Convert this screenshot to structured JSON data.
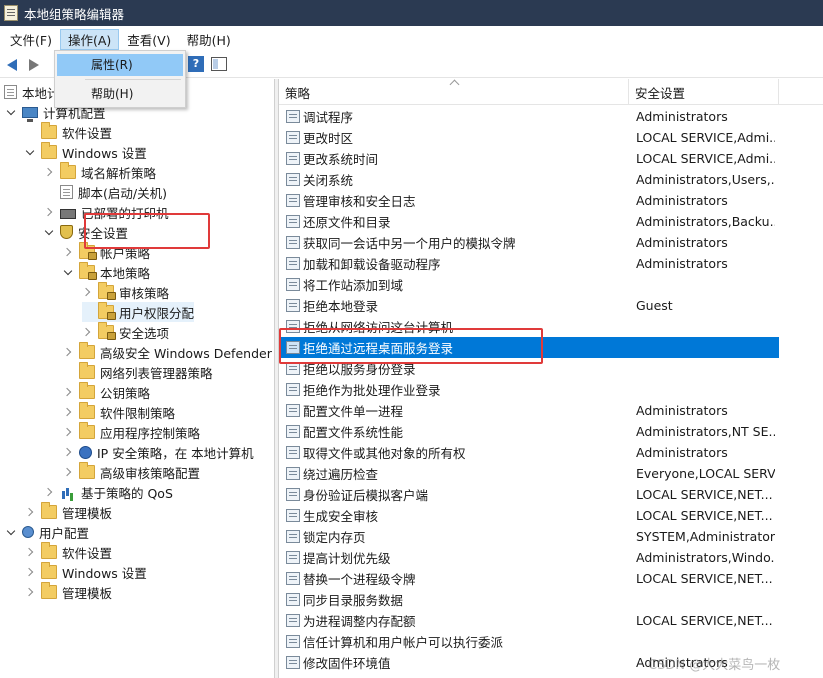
{
  "window": {
    "title": "本地组策略编辑器"
  },
  "menubar": {
    "items": [
      {
        "label": "文件(F)"
      },
      {
        "label": "操作(A)"
      },
      {
        "label": "查看(V)"
      },
      {
        "label": "帮助(H)"
      }
    ]
  },
  "dropdown": {
    "properties": "属性(R)",
    "help": "帮助(H)"
  },
  "tree": {
    "root": "本地计",
    "items": [
      {
        "label": "计算机配置",
        "level": 0,
        "expand": "open",
        "icon": "computer"
      },
      {
        "label": "软件设置",
        "level": 1,
        "expand": "none",
        "icon": "folder"
      },
      {
        "label": "Windows 设置",
        "level": 1,
        "expand": "open",
        "icon": "folder"
      },
      {
        "label": "域名解析策略",
        "level": 2,
        "expand": "closed",
        "icon": "folder"
      },
      {
        "label": "脚本(启动/关机)",
        "level": 2,
        "expand": "none",
        "icon": "doc"
      },
      {
        "label": "已部署的打印机",
        "level": 2,
        "expand": "closed",
        "icon": "printer"
      },
      {
        "label": "安全设置",
        "level": 2,
        "expand": "open",
        "icon": "shield"
      },
      {
        "label": "帐户策略",
        "level": 3,
        "expand": "closed",
        "icon": "folder-lock"
      },
      {
        "label": "本地策略",
        "level": 3,
        "expand": "open",
        "icon": "folder-lock"
      },
      {
        "label": "审核策略",
        "level": 4,
        "expand": "closed",
        "icon": "folder-lock"
      },
      {
        "label": "用户权限分配",
        "level": 4,
        "expand": "none",
        "icon": "folder-lock",
        "selected": true
      },
      {
        "label": "安全选项",
        "level": 4,
        "expand": "closed",
        "icon": "folder-lock"
      },
      {
        "label": "高级安全 Windows Defender 防",
        "level": 3,
        "expand": "closed",
        "icon": "folder"
      },
      {
        "label": "网络列表管理器策略",
        "level": 3,
        "expand": "none",
        "icon": "folder"
      },
      {
        "label": "公钥策略",
        "level": 3,
        "expand": "closed",
        "icon": "folder"
      },
      {
        "label": "软件限制策略",
        "level": 3,
        "expand": "closed",
        "icon": "folder"
      },
      {
        "label": "应用程序控制策略",
        "level": 3,
        "expand": "closed",
        "icon": "folder"
      },
      {
        "label": "IP 安全策略，在 本地计算机",
        "level": 3,
        "expand": "closed",
        "icon": "ipsec"
      },
      {
        "label": "高级审核策略配置",
        "level": 3,
        "expand": "closed",
        "icon": "folder"
      },
      {
        "label": "基于策略的 QoS",
        "level": 2,
        "expand": "closed",
        "icon": "chart"
      },
      {
        "label": "管理模板",
        "level": 1,
        "expand": "closed",
        "icon": "folder"
      },
      {
        "label": "用户配置",
        "level": 0,
        "expand": "open",
        "icon": "user"
      },
      {
        "label": "软件设置",
        "level": 1,
        "expand": "closed",
        "icon": "folder"
      },
      {
        "label": "Windows 设置",
        "level": 1,
        "expand": "closed",
        "icon": "folder"
      },
      {
        "label": "管理模板",
        "level": 1,
        "expand": "closed",
        "icon": "folder"
      }
    ]
  },
  "list": {
    "headers": {
      "policy": "策略",
      "setting": "安全设置"
    },
    "rows": [
      {
        "policy": "调试程序",
        "setting": "Administrators"
      },
      {
        "policy": "更改时区",
        "setting": "LOCAL SERVICE,Admi..."
      },
      {
        "policy": "更改系统时间",
        "setting": "LOCAL SERVICE,Admi..."
      },
      {
        "policy": "关闭系统",
        "setting": "Administrators,Users,..."
      },
      {
        "policy": "管理审核和安全日志",
        "setting": "Administrators"
      },
      {
        "policy": "还原文件和目录",
        "setting": "Administrators,Backu..."
      },
      {
        "policy": "获取同一会话中另一个用户的模拟令牌",
        "setting": "Administrators"
      },
      {
        "policy": "加载和卸载设备驱动程序",
        "setting": "Administrators"
      },
      {
        "policy": "将工作站添加到域",
        "setting": ""
      },
      {
        "policy": "拒绝本地登录",
        "setting": "Guest"
      },
      {
        "policy": "拒绝从网络访问这台计算机",
        "setting": ""
      },
      {
        "policy": "拒绝通过远程桌面服务登录",
        "setting": "",
        "selected": true
      },
      {
        "policy": "拒绝以服务身份登录",
        "setting": ""
      },
      {
        "policy": "拒绝作为批处理作业登录",
        "setting": ""
      },
      {
        "policy": "配置文件单一进程",
        "setting": "Administrators"
      },
      {
        "policy": "配置文件系统性能",
        "setting": "Administrators,NT SE..."
      },
      {
        "policy": "取得文件或其他对象的所有权",
        "setting": "Administrators"
      },
      {
        "policy": "绕过遍历检查",
        "setting": "Everyone,LOCAL SERV..."
      },
      {
        "policy": "身份验证后模拟客户端",
        "setting": "LOCAL SERVICE,NET..."
      },
      {
        "policy": "生成安全审核",
        "setting": "LOCAL SERVICE,NET..."
      },
      {
        "policy": "锁定内存页",
        "setting": "SYSTEM,Administrator"
      },
      {
        "policy": "提高计划优先级",
        "setting": "Administrators,Windo..."
      },
      {
        "policy": "替换一个进程级令牌",
        "setting": "LOCAL SERVICE,NET..."
      },
      {
        "policy": "同步目录服务数据",
        "setting": ""
      },
      {
        "policy": "为进程调整内存配额",
        "setting": "LOCAL SERVICE,NET..."
      },
      {
        "policy": "信任计算机和用户帐户可以执行委派",
        "setting": ""
      },
      {
        "policy": "修改固件环境值",
        "setting": "Administrators"
      }
    ]
  },
  "watermark": "CSDN @大大菜鸟一枚"
}
